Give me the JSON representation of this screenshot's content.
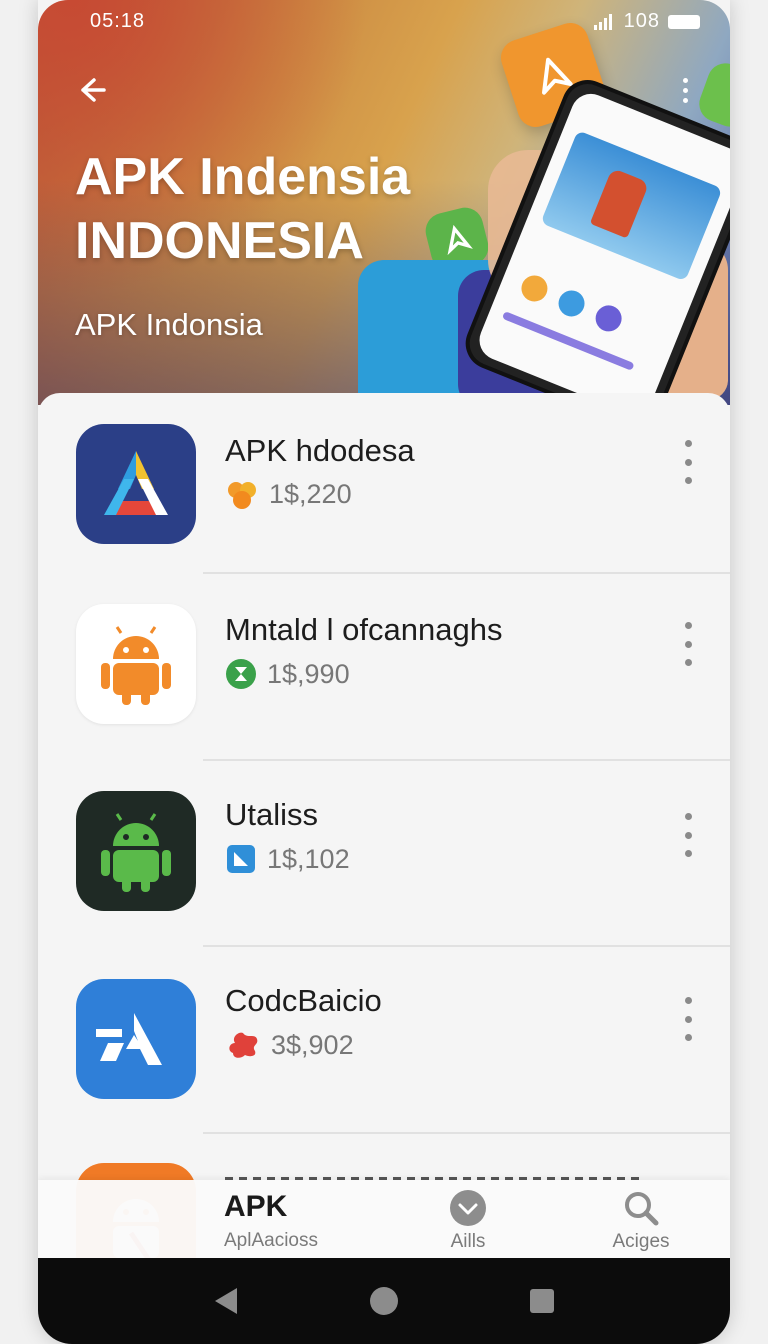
{
  "status_bar": {
    "time": "05:18",
    "battery_text": "108"
  },
  "header": {
    "title_line1": "APK Indensia",
    "title_line2": "INDONESIA",
    "subtitle": "APK Indonsia"
  },
  "apps": [
    {
      "name": "APK hdodesa",
      "count": "1$,220",
      "icon": "apk-a-icon",
      "badge": "orange-star-icon"
    },
    {
      "name": "Mntald l ofcannaghs",
      "count": "1$,990",
      "icon": "android-orange-icon",
      "badge": "green-x-icon"
    },
    {
      "name": "Utaliss",
      "count": "1$,102",
      "icon": "android-green-icon",
      "badge": "blue-doc-icon"
    },
    {
      "name": "CodcBaicio",
      "count": "3$,902",
      "icon": "blue-a-icon",
      "badge": "red-splat-icon"
    }
  ],
  "bottom_nav": [
    {
      "title": "APK",
      "label": "AplAacioss"
    },
    {
      "label": "Aills",
      "icon": "chevron-down-circle-icon"
    },
    {
      "label": "Aciges",
      "icon": "search-icon"
    }
  ],
  "colors": {
    "accent_blue": "#2f7fd8",
    "android_green": "#5aba4a",
    "android_orange": "#f28b2a"
  }
}
